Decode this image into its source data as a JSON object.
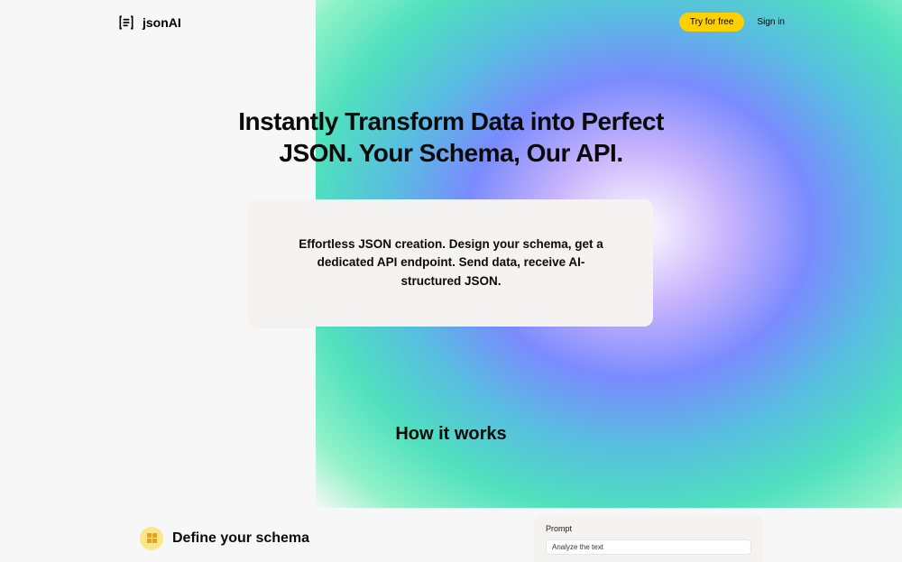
{
  "header": {
    "brand": "jsonAI",
    "try_label": "Try for free",
    "signin_label": "Sign in"
  },
  "hero": {
    "title_line1": "Instantly Transform Data into Perfect",
    "title_line2": "JSON. Your Schema, Our API.",
    "card_text": "Effortless JSON creation. Design your schema, get a dedicated API endpoint. Send data, receive AI-structured JSON."
  },
  "how": {
    "title": "How it works"
  },
  "schema": {
    "title": "Define your schema",
    "prompt_label": "Prompt",
    "prompt_value": "Analyze the text"
  }
}
